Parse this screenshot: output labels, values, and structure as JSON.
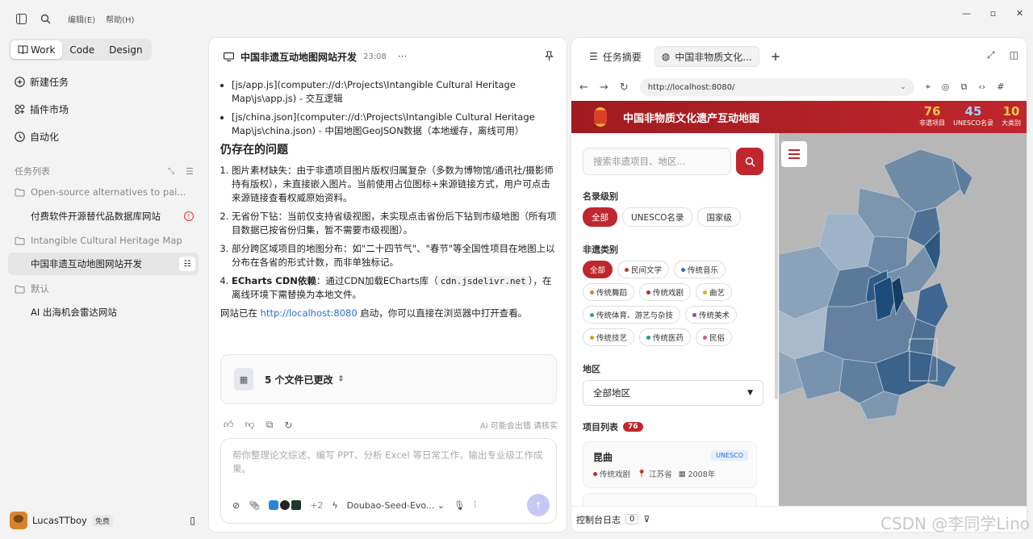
{
  "menu": {
    "edit": "编辑(E)",
    "help": "帮助(H)"
  },
  "modes": [
    "Work",
    "Code",
    "Design"
  ],
  "sidebar": {
    "nav": [
      {
        "label": "新建任务",
        "icon": "plus-circle-icon"
      },
      {
        "label": "插件市场",
        "icon": "puzzle-icon"
      },
      {
        "label": "自动化",
        "icon": "clock-icon"
      }
    ],
    "section_title": "任务列表",
    "tasks": [
      {
        "label": "Open-source alternatives to pai...",
        "folder": true
      },
      {
        "label": "付费软件开源替代品数据库网站",
        "folder": false
      },
      {
        "label": "Intangible Cultural Heritage Map",
        "folder": true
      },
      {
        "label": "中国非遗互动地图网站开发",
        "folder": false
      },
      {
        "label": "默认",
        "folder": true
      },
      {
        "label": "AI 出海机会雷达网站",
        "folder": false
      }
    ],
    "user": {
      "name": "LucasTTboy",
      "plan": "免费"
    }
  },
  "chat": {
    "title": "中国非遗互动地图网站开发",
    "time": "23:08",
    "more": "···",
    "bullets": [
      "[js/app.js](computer://d:\\Projects\\Intangible Cultural Heritage Map\\js\\app.js) - 交互逻辑",
      "[js/china.json](computer://d:\\Projects\\Intangible Cultural Heritage Map\\js\\china.json) - 中国地图GeoJSON数据（本地缓存，离线可用）"
    ],
    "heading": "仍存在的问题",
    "issues": [
      "图片素材缺失：由于非遗项目图片版权归属复杂（多数为博物馆/通讯社/摄影师持有版权），未直接嵌入图片。当前使用占位图标+来源链接方式，用户可点击来源链接查看权威原始资料。",
      "无省份下钻：当前仅支持省级视图，未实现点击省份后下钻到市级地图（所有项目数据已按省份归集，暂不需要市级视图）。",
      "部分跨区域项目的地图分布：如\"二十四节气\"、\"春节\"等全国性项目在地图上以分布在各省的形式计数，而非单独标记。"
    ],
    "issue4_prefix": "ECharts CDN依赖",
    "issue4_mid": "：通过CDN加载ECharts库（",
    "issue4_code": "cdn.jsdelivr.net",
    "issue4_suffix": "），在离线环境下需替换为本地文件。",
    "final_prefix": "网站已在 ",
    "final_link": "http://localhost:8080",
    "final_suffix": " 启动，你可以直接在浏览器中打开查看。",
    "files_changed": "5 个文件已更改",
    "ai_note": "AI 可能会出错 请核实",
    "composer_placeholder": "帮你整理论文综述、编写 PPT、分析 Excel 等日常工作，输出专业级工作成果。",
    "plus_count": "+2",
    "model": "Doubao-Seed-Evo..."
  },
  "browser": {
    "tab_summary": "任务摘要",
    "tab_page": "中国非物质文化...",
    "url": "http://localhost:8080/",
    "site": {
      "title": "中国非物质文化遗产互动地图",
      "stats": [
        {
          "value": "76",
          "label": "非遗项目"
        },
        {
          "value": "45",
          "label": "UNESCO名录"
        },
        {
          "value": "10",
          "label": "大类别"
        }
      ],
      "search_placeholder": "搜索非遗项目、地区...",
      "level_label": "名录级别",
      "levels": [
        "全部",
        "UNESCO名录",
        "国家级"
      ],
      "category_label": "非遗类别",
      "categories": [
        {
          "label": "全部",
          "color": ""
        },
        {
          "label": "民间文学",
          "color": "#c0392b"
        },
        {
          "label": "传统音乐",
          "color": "#2b6dd6"
        },
        {
          "label": "传统舞蹈",
          "color": "#e67e22"
        },
        {
          "label": "传统戏剧",
          "color": "#c0262d"
        },
        {
          "label": "曲艺",
          "color": "#e6a817"
        },
        {
          "label": "传统体育、游艺与杂技",
          "color": "#27ae60"
        },
        {
          "label": "传统美术",
          "color": "#8e44ad"
        },
        {
          "label": "传统技艺",
          "color": "#d4a017"
        },
        {
          "label": "传统医药",
          "color": "#16a085"
        },
        {
          "label": "民俗",
          "color": "#d35497"
        }
      ],
      "region_label": "地区",
      "region_value": "全部地区",
      "list_label": "项目列表",
      "list_count": "76",
      "items": [
        {
          "name": "昆曲",
          "badge": "UNESCO",
          "category": "传统戏剧",
          "province": "江苏省",
          "year": "2008年"
        }
      ]
    },
    "console_label": "控制台日志",
    "console_count": "0"
  },
  "watermark": "CSDN @李同学Lino",
  "colors": {
    "accent": "#c0262d",
    "map_dark": "#1d4b7a",
    "map_light": "#9fb3c8"
  }
}
